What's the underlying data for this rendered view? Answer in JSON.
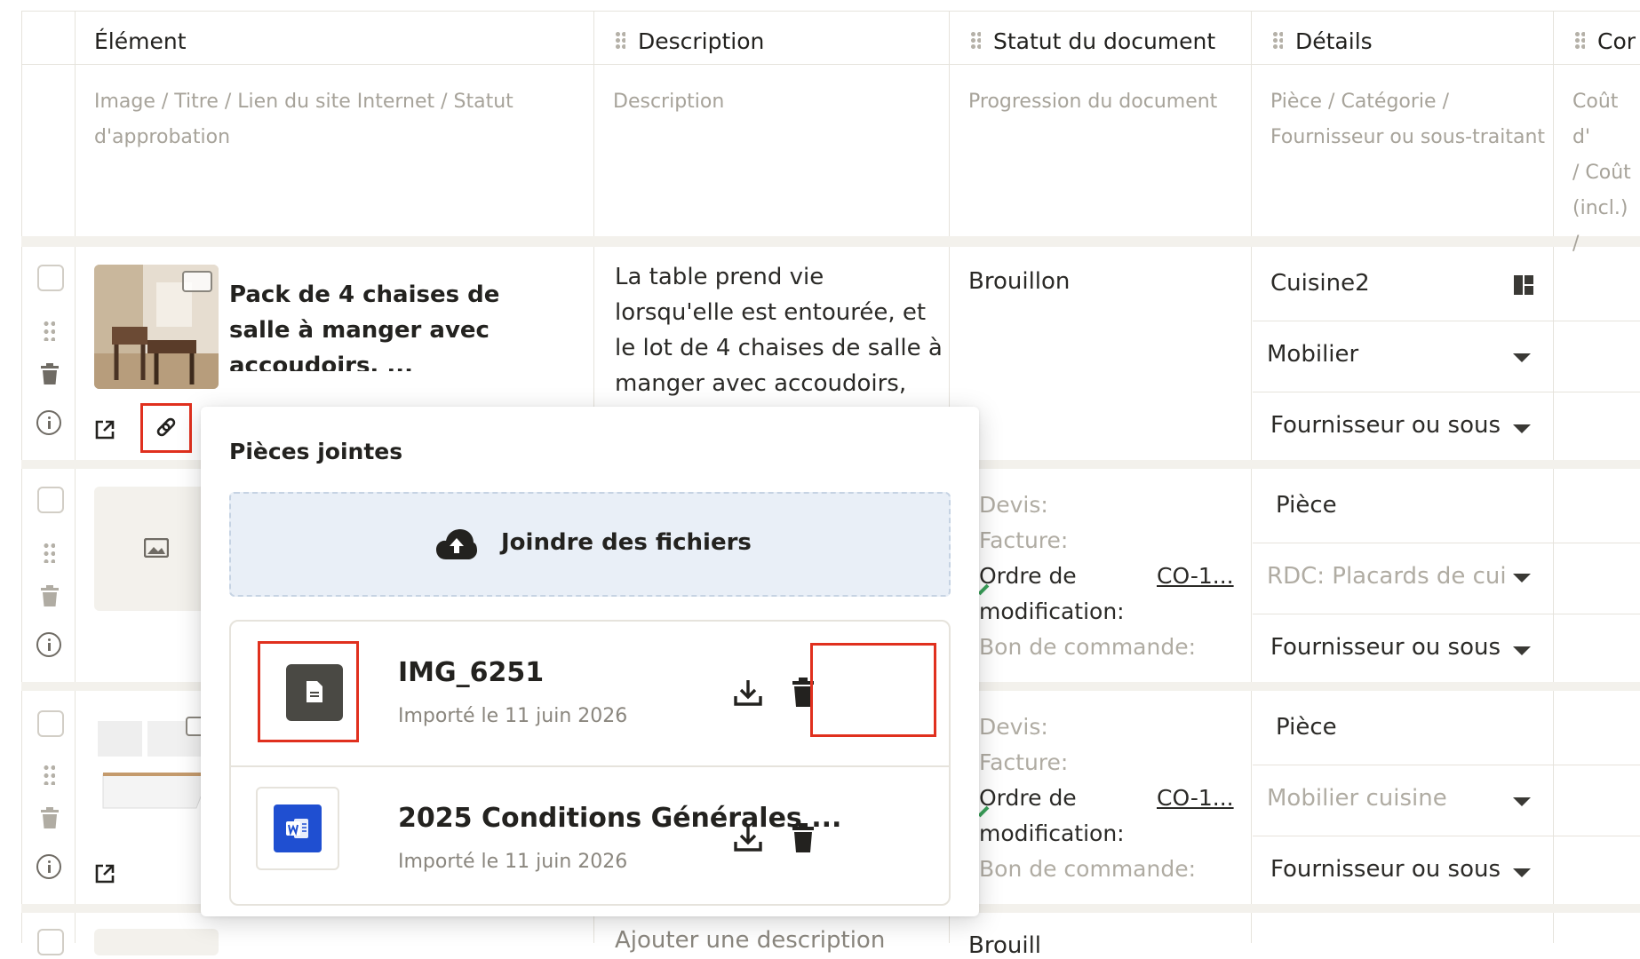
{
  "columns": {
    "element": {
      "title": "Élément",
      "sub": [
        "Image / Titre / Lien du site Internet / Statut",
        "d'approbation"
      ]
    },
    "description": {
      "title": "Description",
      "sub": [
        "Description"
      ]
    },
    "status": {
      "title": "Statut du document",
      "sub": [
        "Progression du document"
      ]
    },
    "details": {
      "title": "Détails",
      "sub": [
        "Pièce / Catégorie /",
        "Fournisseur ou sous-traitant"
      ]
    },
    "cost": {
      "title": "Cor",
      "sub": [
        "Coût d'",
        " / Coût",
        "(incl.) /"
      ]
    }
  },
  "rows": [
    {
      "title": "Pack de 4 chaises de salle à manger avec accoudoirs, ... rembourrées et en bois de",
      "description": "La table prend vie lorsqu'elle est entourée, et le lot de 4 chaises de salle à manger avec accoudoirs, tapissées",
      "status": "Brouillon",
      "details": {
        "room": "Cuisine2",
        "category": "Mobilier",
        "supplier": "Fournisseur ou sous"
      }
    },
    {
      "docs": [
        "Devis:",
        "Facture:",
        "Ordre de",
        "modification:",
        "Bon de commande:"
      ],
      "doc_link": "CO-1...",
      "details": {
        "room": "Pièce",
        "category": "RDC: Placards de cui",
        "supplier": "Fournisseur ou sous"
      }
    },
    {
      "docs": [
        "Devis:",
        "Facture:",
        "Ordre de",
        "modification:",
        "Bon de commande:"
      ],
      "doc_link": "CO-1...",
      "details": {
        "room": "Pièce",
        "category": "Mobilier cuisine",
        "supplier": "Fournisseur ou sous"
      }
    },
    {
      "description": "Ajouter une description",
      "status": "Brouill"
    }
  ],
  "popover": {
    "title": "Pièces jointes",
    "dropzone_label": "Joindre des fichiers",
    "files": [
      {
        "name": "IMG_6251",
        "meta": "Importé le 11 juin 2026",
        "type": "document-icon"
      },
      {
        "name": "2025 Conditions Générales ...",
        "meta": "Importé le 11 juin 2026",
        "type": "word-icon"
      }
    ]
  },
  "colors": {
    "highlight": "#e0301e",
    "word_blue": "#1f4fd1",
    "dropzone_bg": "#e9eff7"
  }
}
